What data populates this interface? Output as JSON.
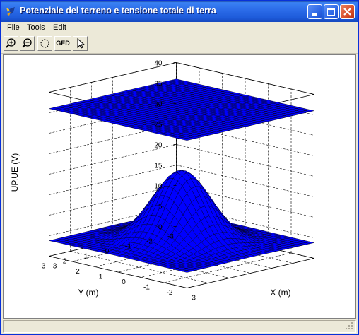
{
  "window": {
    "title": "Potenziale del terreno e tensione totale di terra",
    "controls": [
      "minimize",
      "maximize",
      "close"
    ]
  },
  "menu": {
    "items": [
      "File",
      "Tools",
      "Edit"
    ]
  },
  "toolbar": {
    "buttons": [
      {
        "name": "zoom-in",
        "icon": "zoom-in-icon"
      },
      {
        "name": "zoom-out",
        "icon": "zoom-out-icon"
      },
      {
        "name": "rotate",
        "icon": "rotate-icon"
      },
      {
        "name": "ged",
        "label": "GED"
      },
      {
        "name": "pointer",
        "icon": "pointer-icon"
      }
    ]
  },
  "plot": {
    "zlabel": "UP,UE (V)",
    "xlabel": "X (m)",
    "ylabel": "Y (m)",
    "zticks": [
      "0",
      "5",
      "10",
      "15",
      "20",
      "25",
      "30",
      "35",
      "40"
    ],
    "yticks": [
      "-3",
      "-2",
      "-1",
      "0",
      "1",
      "2",
      "3"
    ],
    "xticks": [
      "-3",
      "-2",
      "-1",
      "0",
      "1",
      "2",
      "3"
    ],
    "surface_color": "#0000FF"
  }
}
